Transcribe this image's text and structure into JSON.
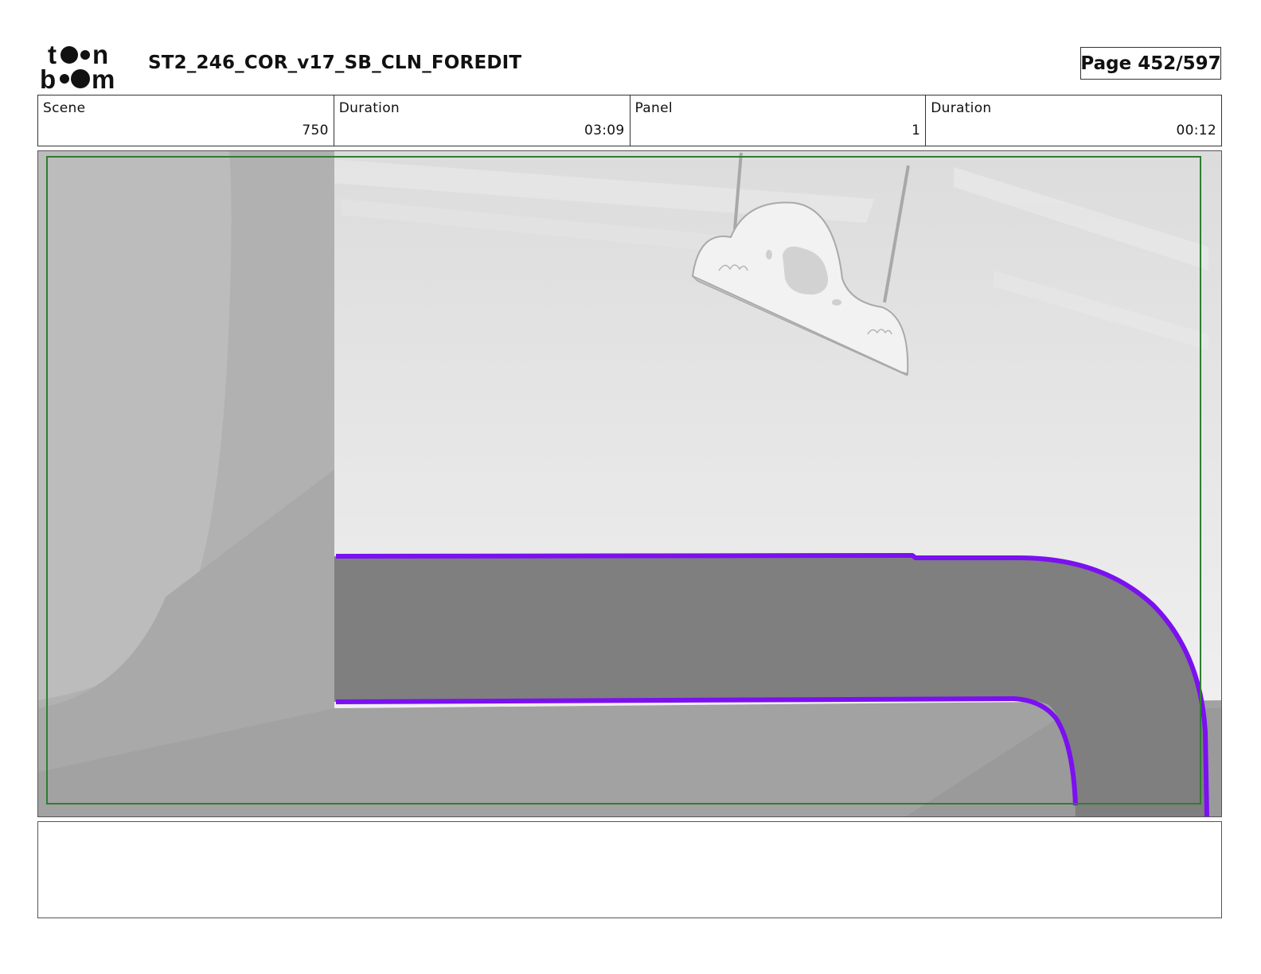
{
  "header": {
    "logo_text": "toon boom",
    "title": "ST2_246_COR_v17_SB_CLN_FOREDIT",
    "page": "Page 452/597"
  },
  "info": [
    {
      "label": "Scene",
      "value": "750"
    },
    {
      "label": "Duration",
      "value": "03:09"
    },
    {
      "label": "Panel",
      "value": "1"
    },
    {
      "label": "Duration",
      "value": "00:12"
    }
  ],
  "panel": {
    "safe_frame_color": "#2e7d32",
    "path_outline_color": "#7b10f0",
    "path_fill_color": "#7f7f7f"
  },
  "notes": {
    "text": ""
  }
}
